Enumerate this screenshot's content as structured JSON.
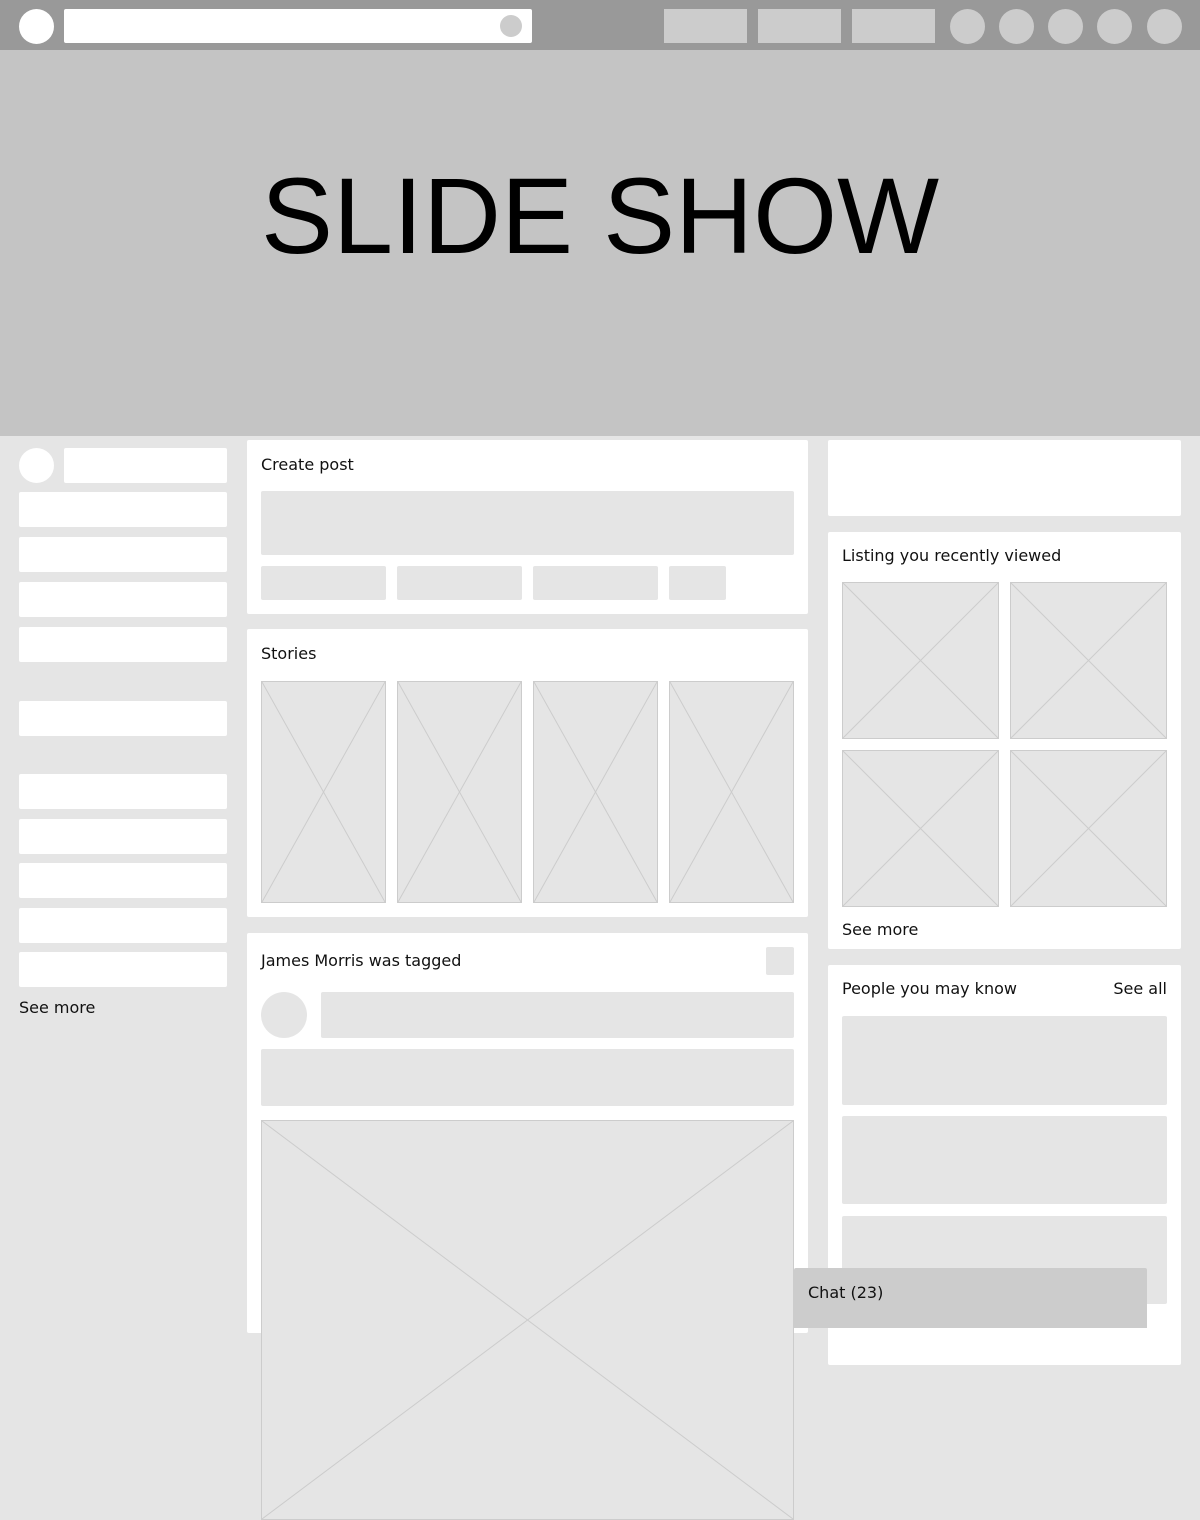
{
  "slideshow": {
    "title": "SLIDE SHOW"
  },
  "left": {
    "see_more": "See more"
  },
  "create_post": {
    "title": "Create post"
  },
  "stories": {
    "title": "Stories"
  },
  "tagged": {
    "title": "James Morris was tagged"
  },
  "listing": {
    "title": "Listing you recently viewed",
    "see_more": "See more"
  },
  "people": {
    "title": "People you may know",
    "see_all": "See all"
  },
  "chat": {
    "label": "Chat (23)"
  }
}
